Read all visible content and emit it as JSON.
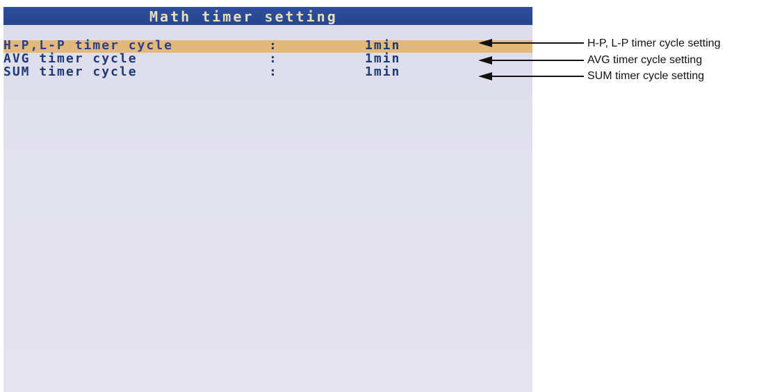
{
  "screen": {
    "title": "Math timer setting",
    "rows": [
      {
        "label": "H-P,L-P timer cycle",
        "separator": ":",
        "value": "1min",
        "selected": true
      },
      {
        "label": "AVG timer cycle",
        "separator": ":",
        "value": "1min",
        "selected": false
      },
      {
        "label": "SUM timer cycle",
        "separator": ":",
        "value": "1min",
        "selected": false
      }
    ],
    "colors": {
      "title_bar": "#2a4a96",
      "title_text": "#e8dfb8",
      "background": "#e2e1ee",
      "highlight": "#e2b87b",
      "text": "#1f3a78"
    }
  },
  "annotations": [
    {
      "text": "H-P, L-P timer cycle setting",
      "icon": "arrow-left-icon"
    },
    {
      "text": "AVG timer cycle setting",
      "icon": "arrow-left-icon"
    },
    {
      "text": "SUM timer cycle setting",
      "icon": "arrow-left-icon"
    }
  ]
}
